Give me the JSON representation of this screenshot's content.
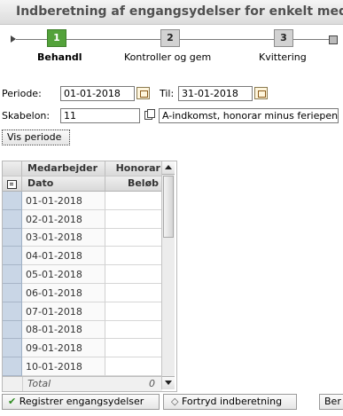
{
  "window": {
    "title": "Indberetning af engangsydelser for enkelt medarbejder"
  },
  "wizard": {
    "steps": [
      {
        "number": "1",
        "label": "Behandl"
      },
      {
        "number": "2",
        "label": "Kontroller og gem"
      },
      {
        "number": "3",
        "label": "Kvittering"
      }
    ],
    "active_step": 1
  },
  "form": {
    "periode_label": "Periode:",
    "periode_from": "01-01-2018",
    "til_label": "Til:",
    "periode_to": "31-01-2018",
    "skabelon_label": "Skabelon:",
    "skabelon_value": "11",
    "skabelon_description": "A-indkomst, honorar minus feriepenge",
    "vis_periode_button": "Vis periode"
  },
  "grid": {
    "header_row1": [
      "Medarbejder",
      "Honorar"
    ],
    "header_row2": [
      "Dato",
      "Beløb"
    ],
    "rows": [
      "01-01-2018",
      "02-01-2018",
      "03-01-2018",
      "04-01-2018",
      "05-01-2018",
      "06-01-2018",
      "07-01-2018",
      "08-01-2018",
      "09-01-2018",
      "10-01-2018"
    ],
    "total_label": "Total",
    "total_value": "0"
  },
  "buttons": {
    "registrer": "Registrer engangsydelser",
    "fortryd": "Fortryd indberetning",
    "third": "Ber"
  },
  "colors": {
    "active_step": "#53a23a",
    "row_header": "#c9d6e6"
  }
}
